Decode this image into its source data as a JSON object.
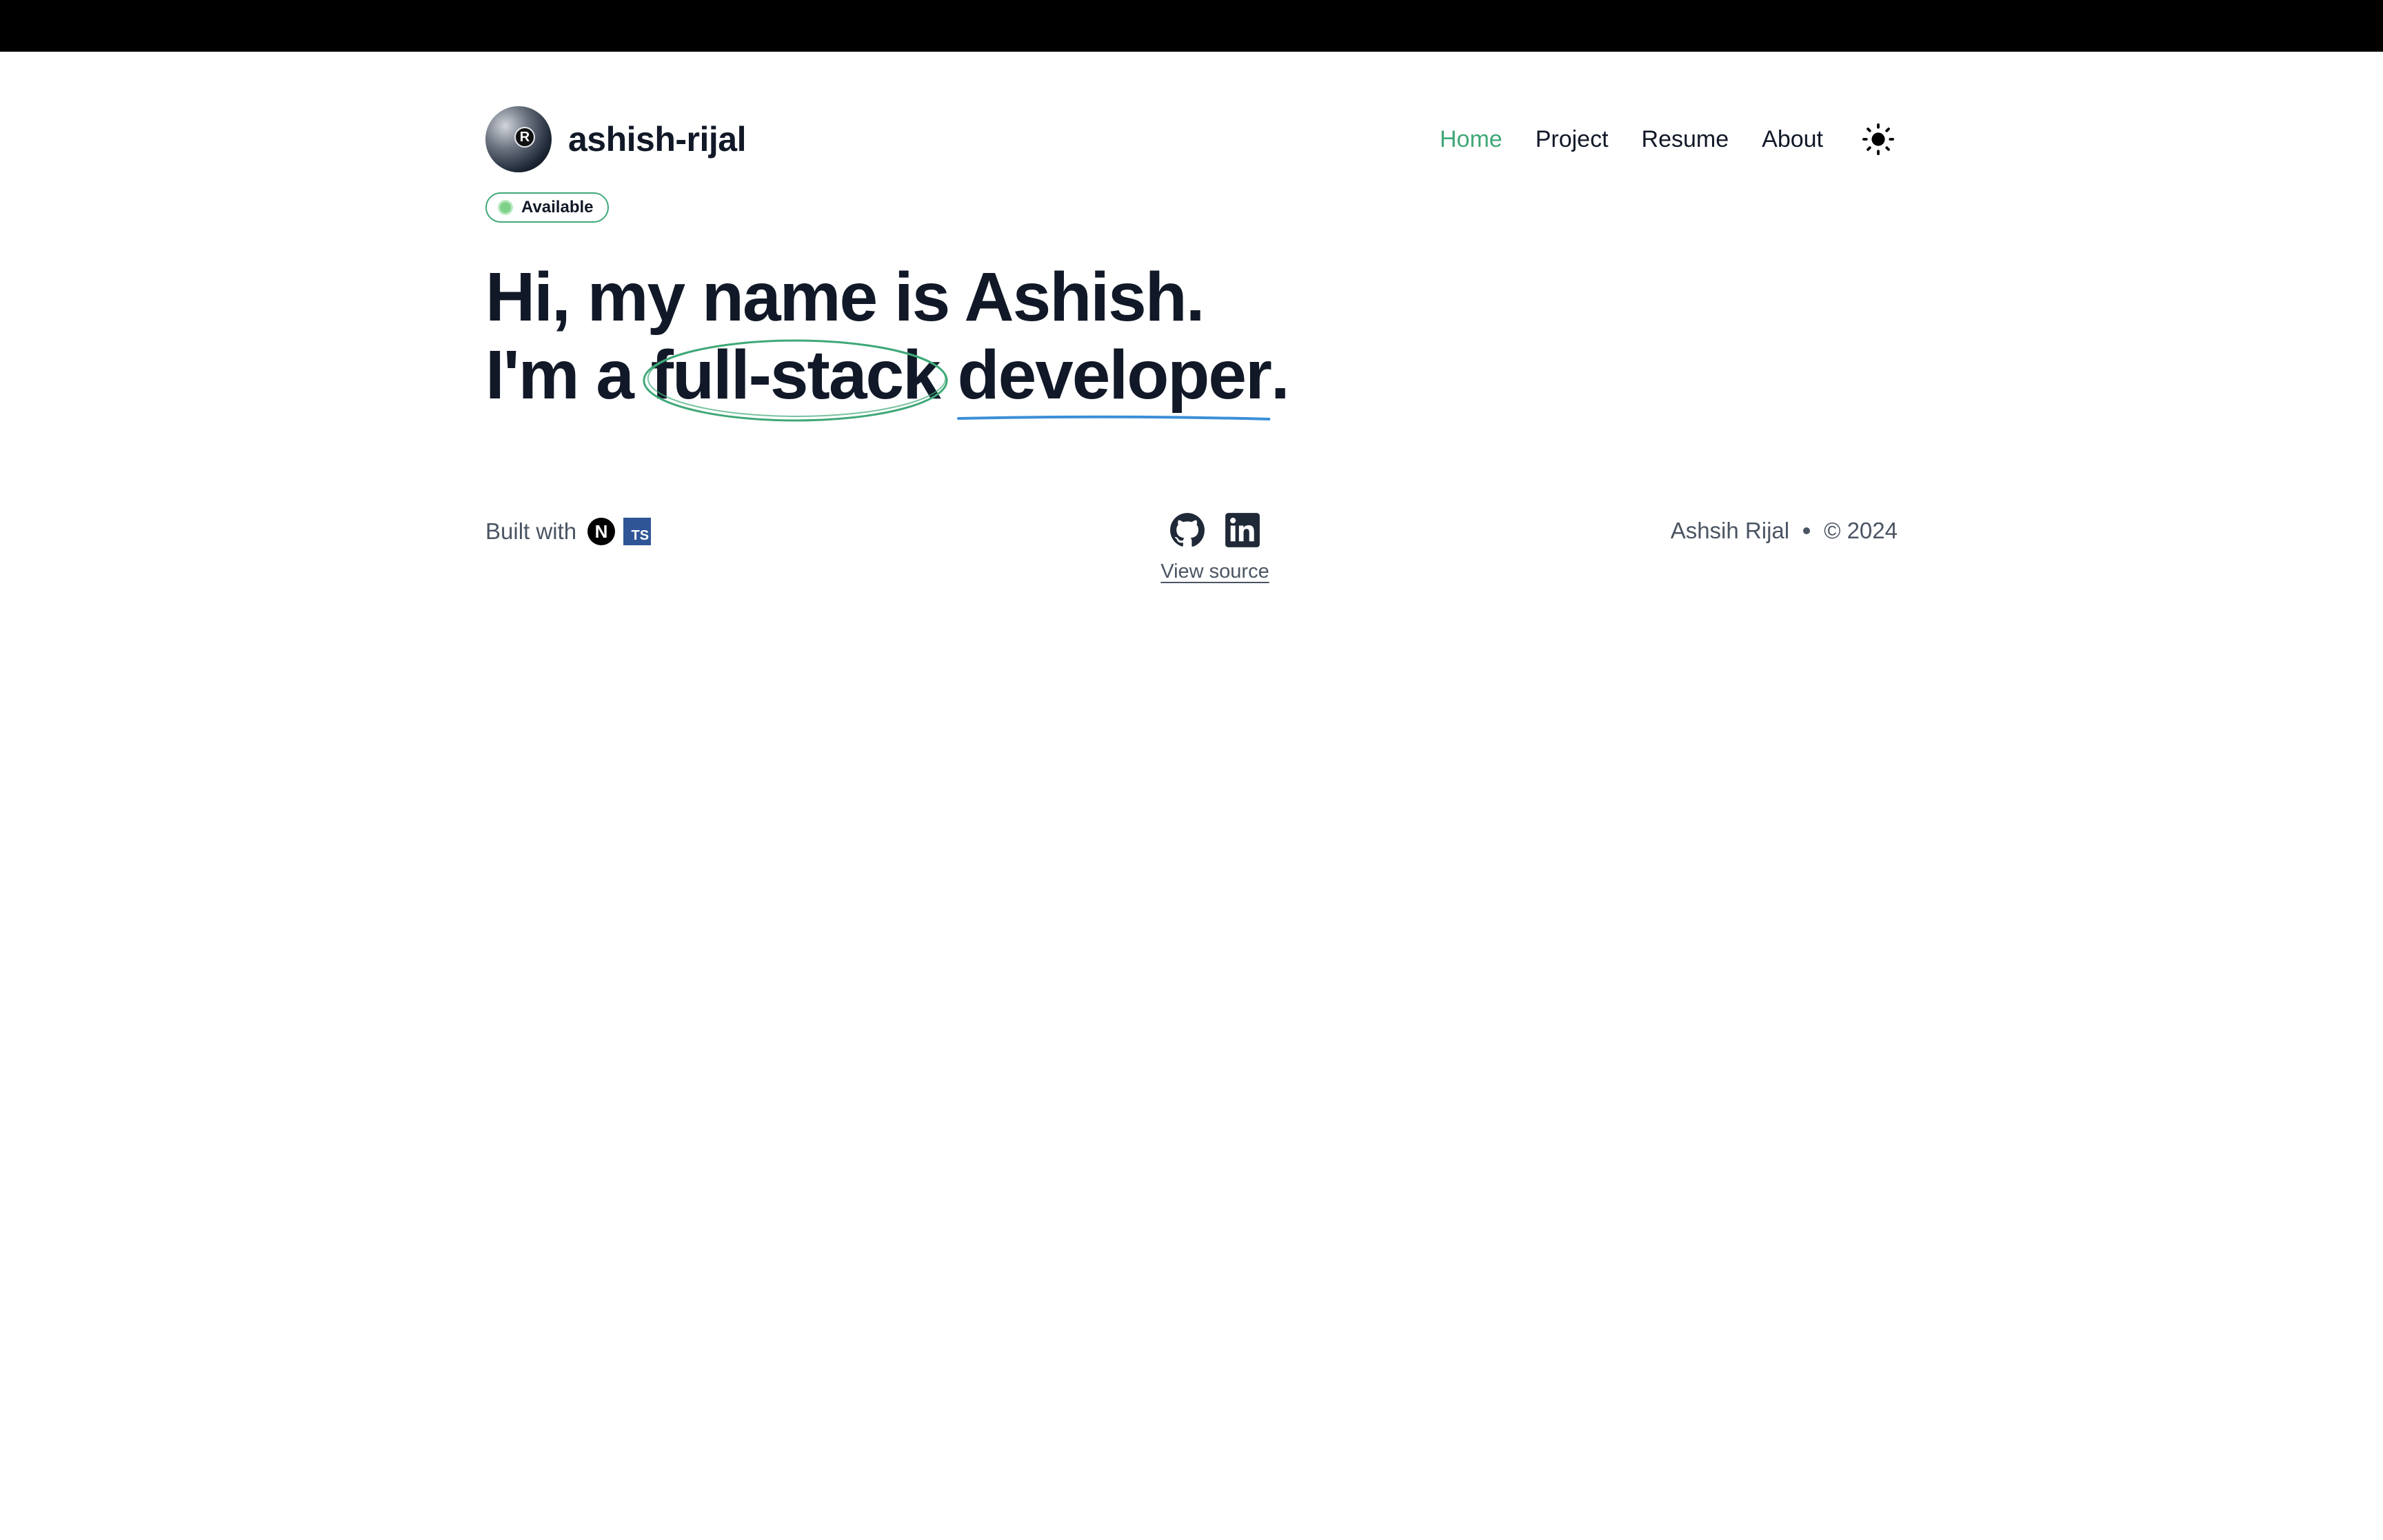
{
  "header": {
    "brand_name": "ashish-rijal",
    "avatar_letter": "R",
    "status_badge": "Available",
    "nav": [
      {
        "label": "Home",
        "active": true
      },
      {
        "label": "Project",
        "active": false
      },
      {
        "label": "Resume",
        "active": false
      },
      {
        "label": "About",
        "active": false
      }
    ],
    "theme_icon": "sun-icon"
  },
  "hero": {
    "line1": "Hi, my name is Ashish.",
    "line2_prefix": "I'm a ",
    "line2_circled": "full-stack",
    "line2_underlined": "developer",
    "line2_suffix": "."
  },
  "footer": {
    "built_with_label": "Built with",
    "tech_icons": [
      "nextjs-icon",
      "typescript-icon"
    ],
    "nextjs_letter": "N",
    "typescript_letters": "TS",
    "social_icons": [
      "github-icon",
      "linkedin-icon"
    ],
    "view_source_label": "View source",
    "author": "Ashsih Rijal",
    "copyright": "© 2024"
  },
  "colors": {
    "accent": "#3fa877",
    "underline": "#3b8fd9",
    "text": "#111827",
    "muted": "#4b5563"
  }
}
